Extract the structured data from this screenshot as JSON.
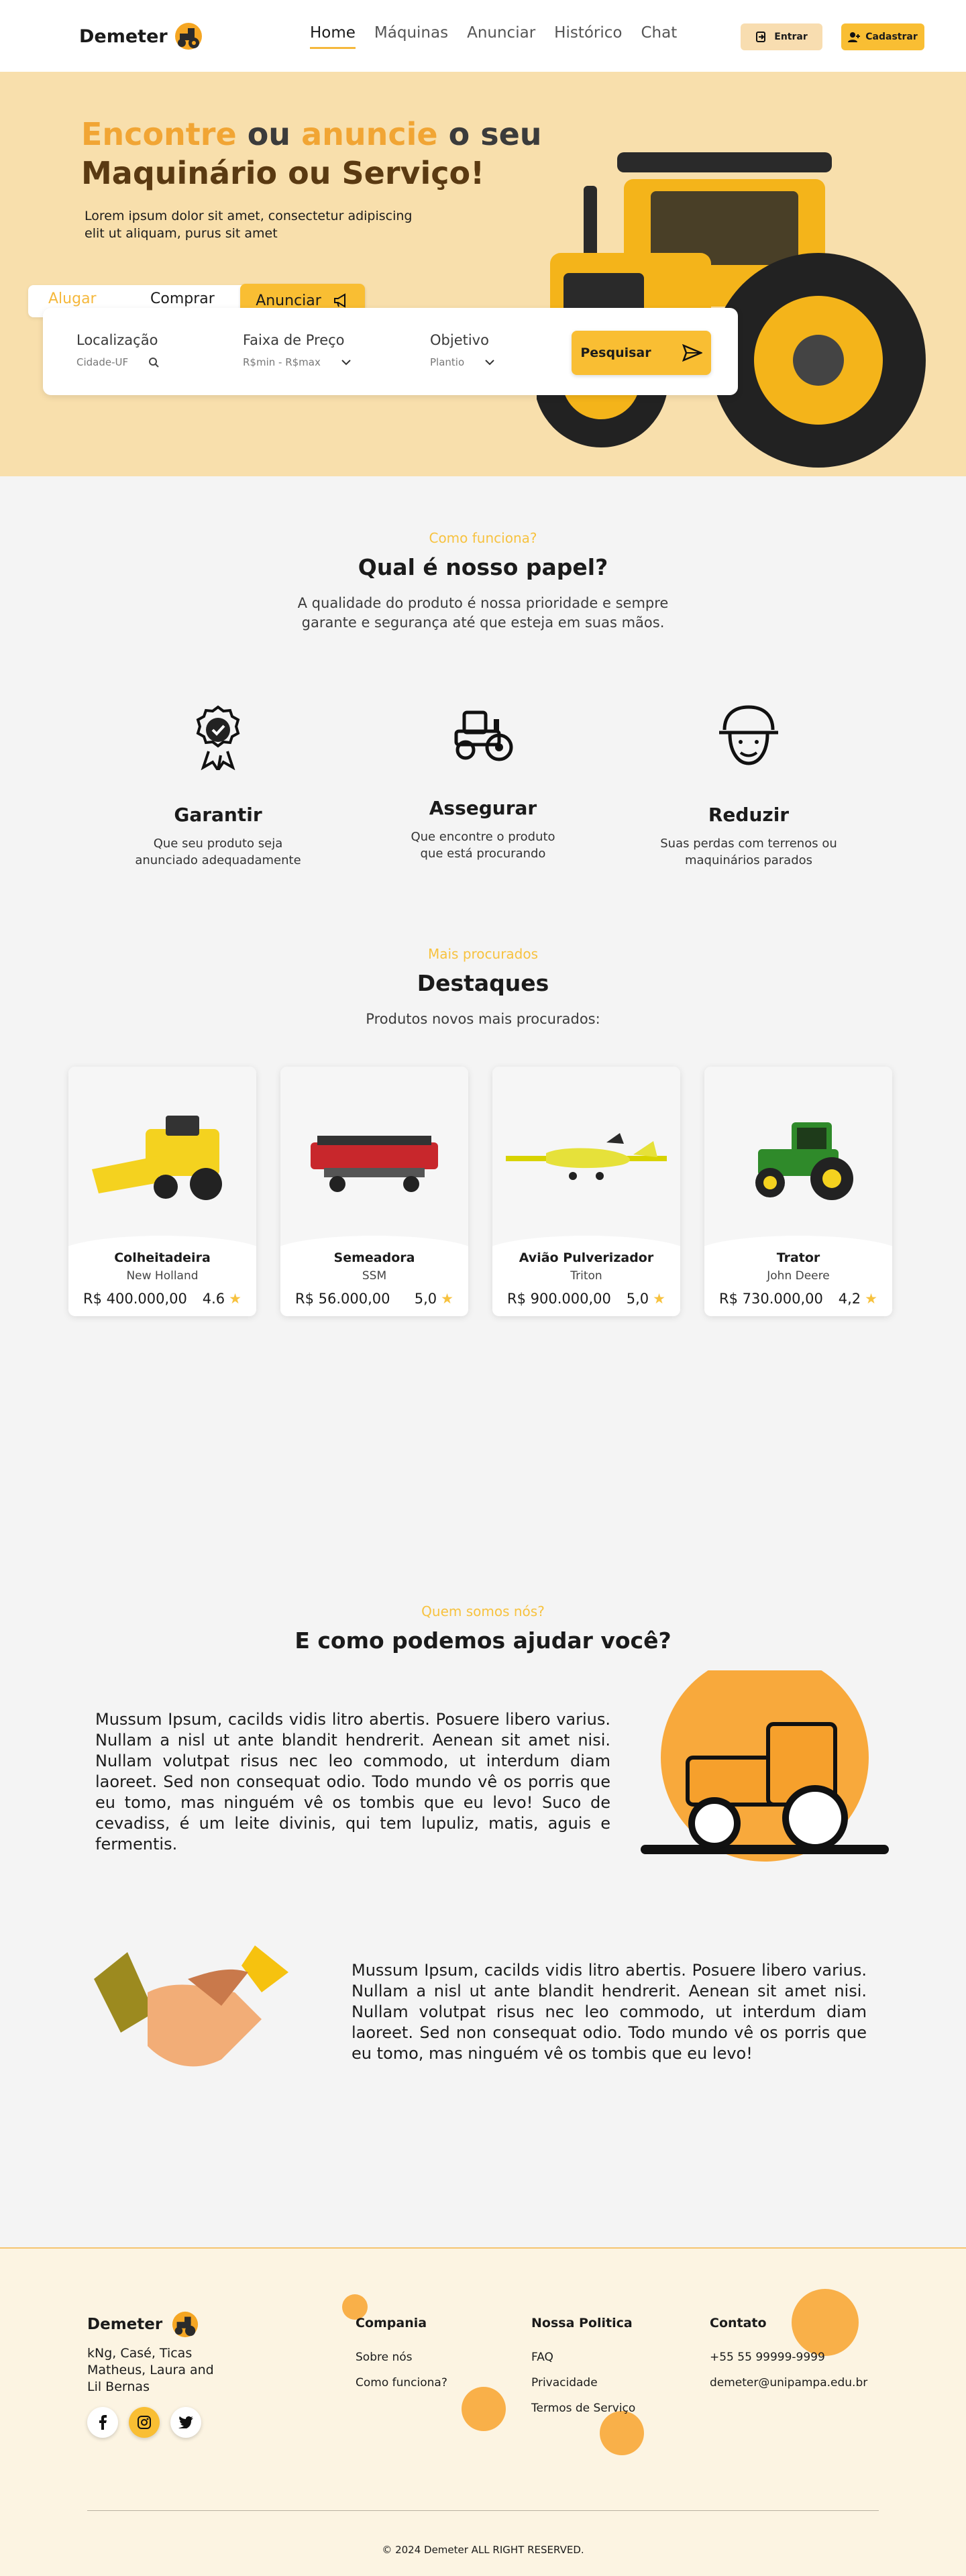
{
  "header": {
    "brand": "Demeter",
    "nav": [
      "Home",
      "Máquinas",
      "Anunciar",
      "Histórico",
      "Chat"
    ],
    "login_label": "Entrar",
    "signup_label": "Cadastrar"
  },
  "hero": {
    "title_word1": "Encontre",
    "title_word2": "ou",
    "title_word3": "anuncie",
    "title_word4": "o seu",
    "title_line2": "Maquinário ou Serviço!",
    "subtitle": "Lorem ipsum dolor sit amet, consectetur adipiscing elit ut aliquam, purus sit amet",
    "tabs": {
      "rent": "Alugar",
      "buy": "Comprar",
      "announce": "Anunciar"
    },
    "fields": {
      "location_label": "Localização",
      "location_placeholder": "Cidade-UF",
      "price_label": "Faixa de Preço",
      "price_value": "R$min - R$max",
      "goal_label": "Objetivo",
      "goal_value": "Plantio"
    },
    "search_label": "Pesquisar"
  },
  "role": {
    "kicker": "Como funciona?",
    "heading": "Qual é nosso papel?",
    "subtext": "A qualidade do produto é nossa prioridade e sempre garante e segurança até que esteja em suas mãos.",
    "features": [
      {
        "icon": "award-badge-icon",
        "title": "Garantir",
        "desc": "Que seu produto seja anunciado adequadamente"
      },
      {
        "icon": "tractor-icon",
        "title": "Assegurar",
        "desc": "Que encontre o produto que está procurando"
      },
      {
        "icon": "farmer-icon",
        "title": "Reduzir",
        "desc": "Suas perdas com terrenos ou maquinários parados"
      }
    ]
  },
  "highlights": {
    "kicker": "Mais procurados",
    "heading": "Destaques",
    "subtext": "Produtos novos mais procurados:",
    "products": [
      {
        "name": "Colheitadeira",
        "brand": "New Holland",
        "price": "R$ 400.000,00",
        "rating": "4.6"
      },
      {
        "name": "Semeadora",
        "brand": "SSM",
        "price": "R$ 56.000,00",
        "rating": "5,0"
      },
      {
        "name": "Avião Pulverizador",
        "brand": "Triton",
        "price": "R$ 900.000,00",
        "rating": "5,0"
      },
      {
        "name": "Trator",
        "brand": "John Deere",
        "price": "R$ 730.000,00",
        "rating": "4,2"
      }
    ]
  },
  "about": {
    "kicker": "Quem somos nós?",
    "heading": "E como podemos ajudar você?",
    "para1": "Mussum Ipsum, cacilds vidis litro abertis. Posuere libero varius. Nullam a nisl ut ante blandit hendrerit. Aenean sit amet nisi. Nullam volutpat risus nec leo commodo, ut interdum diam laoreet. Sed non consequat odio. Todo mundo vê os porris que eu tomo, mas ninguém vê os tombis que eu levo! Suco de cevadiss, é um leite divinis, qui tem lupuliz, matis, aguis e fermentis.",
    "para2": "Mussum Ipsum, cacilds vidis litro abertis. Posuere libero varius. Nullam a nisl ut ante blandit hendrerit. Aenean sit amet nisi. Nullam volutpat risus nec leo commodo, ut interdum diam laoreet. Sed non consequat odio. Todo mundo vê os porris que eu tomo, mas ninguém vê os tombis que eu levo!"
  },
  "footer": {
    "brand": "Demeter",
    "team": "kNg, Casé, Ticas Matheus, Laura and Lil Bernas",
    "company_title": "Compania",
    "company_links": [
      "Sobre nós",
      "Como funciona?"
    ],
    "policy_title": "Nossa Politica",
    "policy_links": [
      "FAQ",
      "Privacidade",
      "Termos de Serviço"
    ],
    "contact_title": "Contato",
    "phone": "+55 55 99999-9999",
    "email": "demeter@unipampa.edu.br",
    "copyright": "© 2024 Demeter ALL RIGHT RESERVED."
  },
  "colors": {
    "accent": "#f9be33",
    "hero_bg": "#f8dfac",
    "page_bg": "#f4f4f4",
    "footer_bg": "#fcf4e2",
    "bubble": "#f8a93c"
  }
}
